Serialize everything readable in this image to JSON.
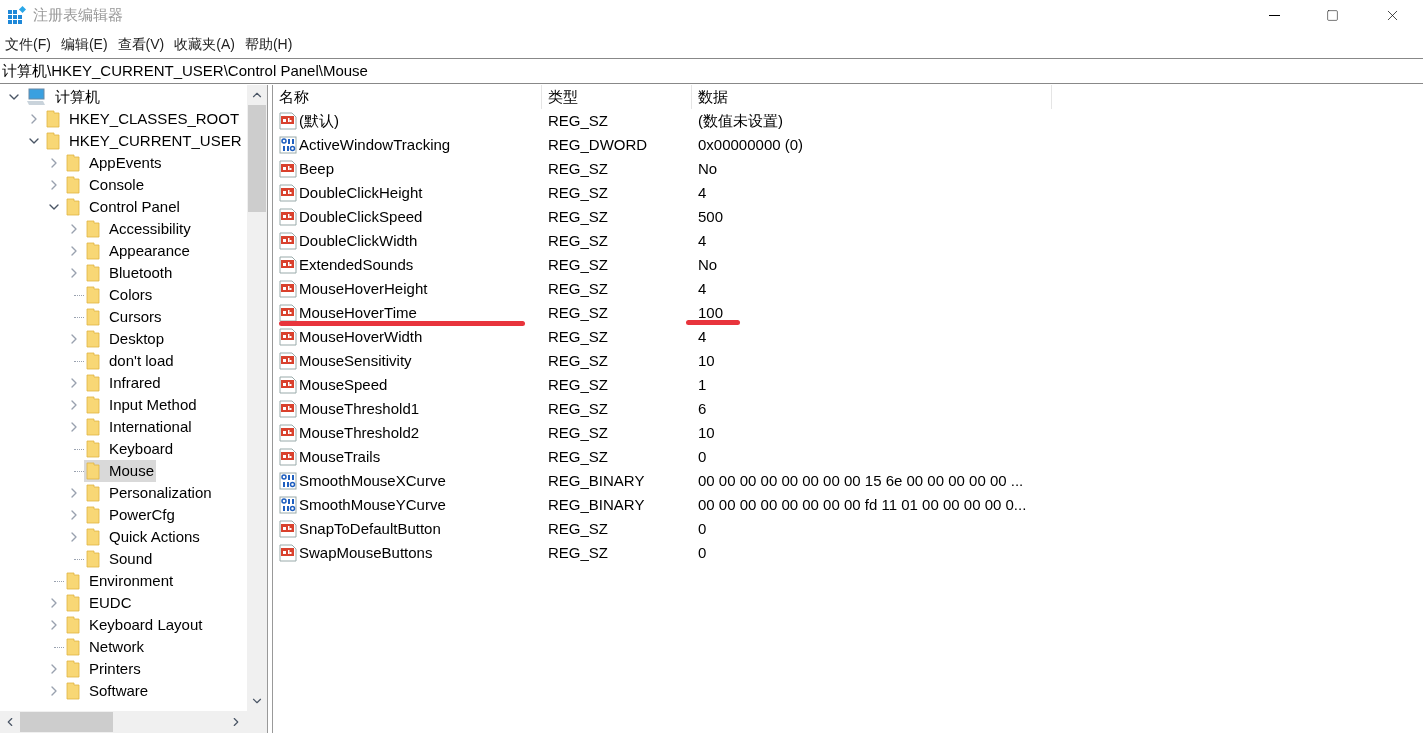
{
  "window": {
    "title": "注册表编辑器"
  },
  "menu": [
    "文件(F)",
    "编辑(E)",
    "查看(V)",
    "收藏夹(A)",
    "帮助(H)"
  ],
  "address": "计算机\\HKEY_CURRENT_USER\\Control Panel\\Mouse",
  "tree": [
    {
      "label": "计算机",
      "kind": "computer",
      "expanded": true,
      "selected": false,
      "children": [
        {
          "label": "HKEY_CLASSES_ROOT",
          "kind": "branch",
          "expanded": false,
          "selected": false
        },
        {
          "label": "HKEY_CURRENT_USER",
          "kind": "branch",
          "expanded": true,
          "selected": false,
          "children": [
            {
              "label": "AppEvents",
              "kind": "branch",
              "expanded": false,
              "selected": false
            },
            {
              "label": "Console",
              "kind": "branch",
              "expanded": false,
              "selected": false
            },
            {
              "label": "Control Panel",
              "kind": "branch",
              "expanded": true,
              "selected": false,
              "children": [
                {
                  "label": "Accessibility",
                  "kind": "branch",
                  "expanded": false,
                  "selected": false
                },
                {
                  "label": "Appearance",
                  "kind": "branch",
                  "expanded": false,
                  "selected": false
                },
                {
                  "label": "Bluetooth",
                  "kind": "branch",
                  "expanded": false,
                  "selected": false
                },
                {
                  "label": "Colors",
                  "kind": "leaf",
                  "selected": false
                },
                {
                  "label": "Cursors",
                  "kind": "leaf",
                  "selected": false
                },
                {
                  "label": "Desktop",
                  "kind": "branch",
                  "expanded": false,
                  "selected": false
                },
                {
                  "label": "don't load",
                  "kind": "leaf",
                  "selected": false
                },
                {
                  "label": "Infrared",
                  "kind": "branch",
                  "expanded": false,
                  "selected": false
                },
                {
                  "label": "Input Method",
                  "kind": "branch",
                  "expanded": false,
                  "selected": false
                },
                {
                  "label": "International",
                  "kind": "branch",
                  "expanded": false,
                  "selected": false
                },
                {
                  "label": "Keyboard",
                  "kind": "leaf",
                  "selected": false
                },
                {
                  "label": "Mouse",
                  "kind": "leaf",
                  "selected": true
                },
                {
                  "label": "Personalization",
                  "kind": "branch",
                  "expanded": false,
                  "selected": false
                },
                {
                  "label": "PowerCfg",
                  "kind": "branch",
                  "expanded": false,
                  "selected": false
                },
                {
                  "label": "Quick Actions",
                  "kind": "branch",
                  "expanded": false,
                  "selected": false
                },
                {
                  "label": "Sound",
                  "kind": "leaf",
                  "selected": false
                }
              ]
            },
            {
              "label": "Environment",
              "kind": "leaf",
              "selected": false
            },
            {
              "label": "EUDC",
              "kind": "branch",
              "expanded": false,
              "selected": false
            },
            {
              "label": "Keyboard Layout",
              "kind": "branch",
              "expanded": false,
              "selected": false
            },
            {
              "label": "Network",
              "kind": "leaf",
              "selected": false
            },
            {
              "label": "Printers",
              "kind": "branch",
              "expanded": false,
              "selected": false
            },
            {
              "label": "Software",
              "kind": "branch",
              "expanded": false,
              "selected": false
            }
          ]
        }
      ]
    }
  ],
  "table": {
    "columns": [
      "名称",
      "类型",
      "数据"
    ],
    "rows": [
      {
        "kind": "string",
        "name": "(默认)",
        "type": "REG_SZ",
        "data": "(数值未设置)",
        "marked": false
      },
      {
        "kind": "binary",
        "name": "ActiveWindowTracking",
        "type": "REG_DWORD",
        "data": "0x00000000 (0)",
        "marked": false
      },
      {
        "kind": "string",
        "name": "Beep",
        "type": "REG_SZ",
        "data": "No",
        "marked": false
      },
      {
        "kind": "string",
        "name": "DoubleClickHeight",
        "type": "REG_SZ",
        "data": "4",
        "marked": false
      },
      {
        "kind": "string",
        "name": "DoubleClickSpeed",
        "type": "REG_SZ",
        "data": "500",
        "marked": false
      },
      {
        "kind": "string",
        "name": "DoubleClickWidth",
        "type": "REG_SZ",
        "data": "4",
        "marked": false
      },
      {
        "kind": "string",
        "name": "ExtendedSounds",
        "type": "REG_SZ",
        "data": "No",
        "marked": false
      },
      {
        "kind": "string",
        "name": "MouseHoverHeight",
        "type": "REG_SZ",
        "data": "4",
        "marked": false
      },
      {
        "kind": "string",
        "name": "MouseHoverTime",
        "type": "REG_SZ",
        "data": "100",
        "marked": true
      },
      {
        "kind": "string",
        "name": "MouseHoverWidth",
        "type": "REG_SZ",
        "data": "4",
        "marked": false
      },
      {
        "kind": "string",
        "name": "MouseSensitivity",
        "type": "REG_SZ",
        "data": "10",
        "marked": false
      },
      {
        "kind": "string",
        "name": "MouseSpeed",
        "type": "REG_SZ",
        "data": "1",
        "marked": false
      },
      {
        "kind": "string",
        "name": "MouseThreshold1",
        "type": "REG_SZ",
        "data": "6",
        "marked": false
      },
      {
        "kind": "string",
        "name": "MouseThreshold2",
        "type": "REG_SZ",
        "data": "10",
        "marked": false
      },
      {
        "kind": "string",
        "name": "MouseTrails",
        "type": "REG_SZ",
        "data": "0",
        "marked": false
      },
      {
        "kind": "binary",
        "name": "SmoothMouseXCurve",
        "type": "REG_BINARY",
        "data": "00 00 00 00 00 00 00 00 15 6e 00 00 00 00 00 ...",
        "marked": false
      },
      {
        "kind": "binary",
        "name": "SmoothMouseYCurve",
        "type": "REG_BINARY",
        "data": "00 00 00 00 00 00 00 00 fd 11 01 00 00 00 00 0...",
        "marked": false
      },
      {
        "kind": "string",
        "name": "SnapToDefaultButton",
        "type": "REG_SZ",
        "data": "0",
        "marked": false
      },
      {
        "kind": "string",
        "name": "SwapMouseButtons",
        "type": "REG_SZ",
        "data": "0",
        "marked": false
      }
    ]
  }
}
